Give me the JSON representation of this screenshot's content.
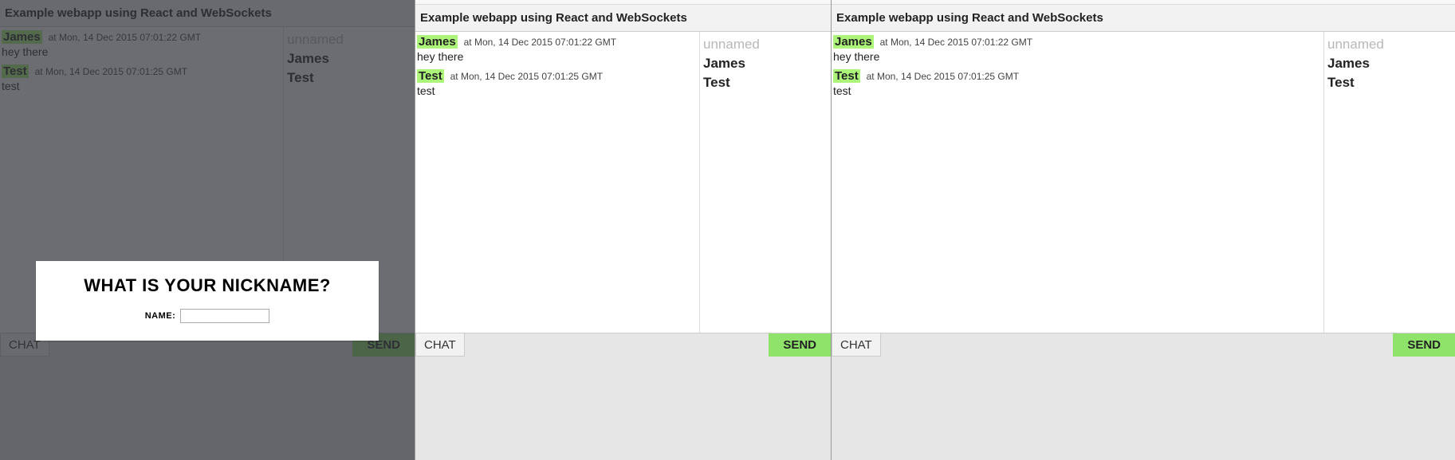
{
  "app_title": "Example webapp using React and WebSockets",
  "messages": [
    {
      "author": "James",
      "ts": "at Mon, 14 Dec 2015 07:01:22 GMT",
      "text": "hey there"
    },
    {
      "author": "Test",
      "ts": "at Mon, 14 Dec 2015 07:01:25 GMT",
      "text": "test"
    }
  ],
  "users": {
    "placeholder": "unnamed",
    "list": [
      "James",
      "Test"
    ]
  },
  "footer": {
    "chat_label": "CHAT",
    "send_label": "SEND"
  },
  "modal": {
    "title": "WHAT IS YOUR NICKNAME?",
    "label": "NAME:",
    "value": ""
  }
}
